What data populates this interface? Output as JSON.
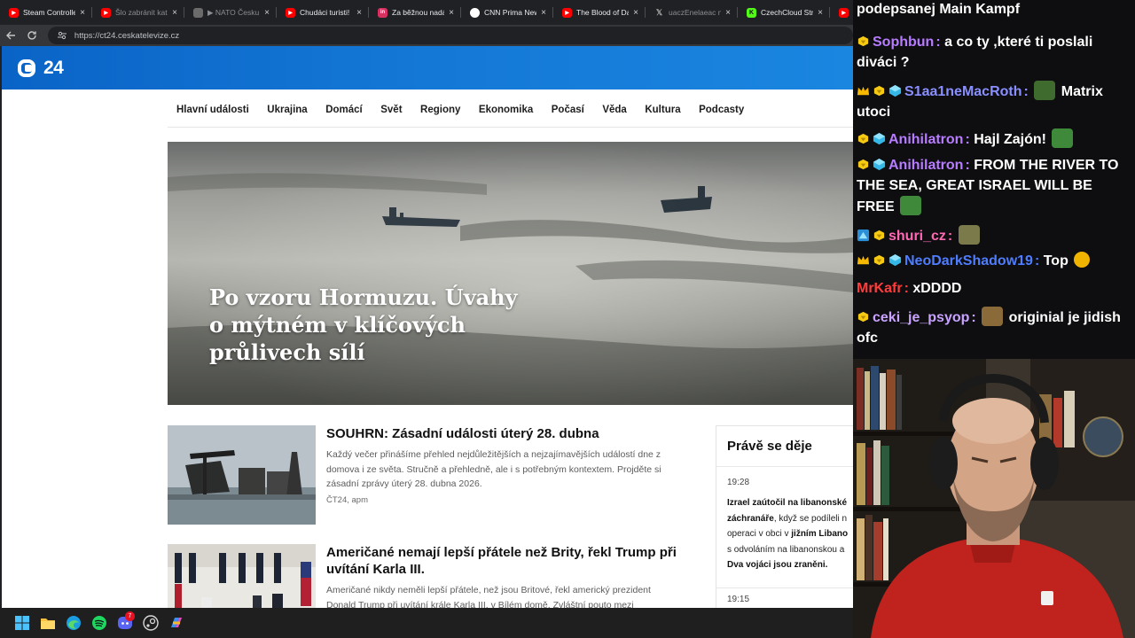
{
  "browser": {
    "tabs": [
      {
        "title": "Steam Controller:",
        "favicon_color": "#ff0000",
        "favicon": "yt"
      },
      {
        "title": "Šlo zabránit katas",
        "favicon_color": "#ff0000",
        "favicon": "yt"
      },
      {
        "title": "▶ NATO Česku ne",
        "favicon_color": "#6b6b6b",
        "favicon": "img"
      },
      {
        "title": "Chudáci turisti! Sk",
        "favicon_color": "#ff0000",
        "favicon": "yt"
      },
      {
        "title": "Za běžnou nadávk",
        "favicon_color": "#d9315f",
        "favicon": "in"
      },
      {
        "title": "CNN Prima News",
        "favicon_color": "#ffffff",
        "favicon": "cnn"
      },
      {
        "title": "The Blood of Daw",
        "favicon_color": "#ff0000",
        "favicon": "yt"
      },
      {
        "title": "uaczEnelaeac na g",
        "favicon_color": "#3a3a3a",
        "favicon": "x"
      },
      {
        "title": "CzechCloud Strea",
        "favicon_color": "#53fc18",
        "favicon": "k"
      },
      {
        "title": "The",
        "favicon_color": "#ff0000",
        "favicon": "yt"
      }
    ],
    "url": "https://ct24.ceskatelevize.cz"
  },
  "site": {
    "logo_text": "24",
    "menu": [
      "Hlavní události",
      "Ukrajina",
      "Domácí",
      "Svět",
      "Regiony",
      "Ekonomika",
      "Počasí",
      "Věda",
      "Kultura",
      "Podcasty"
    ],
    "hero_title": "Po vzoru Hormuzu. Úvahy o mýtném v klíčových průlivech sílí",
    "articles": [
      {
        "headline": "SOUHRN: Zásadní události úterý 28. dubna",
        "perex": "Každý večer přinášíme přehled nejdůležitějších a nejzajímavějších událostí dne z domova i ze světa. Stručně a přehledně, ale i s potřebným kontextem. Projděte si zásadní zprávy úterý 28. dubna 2026.",
        "meta": "ČT24, apm"
      },
      {
        "headline": "Američané nemají lepší přátele než Brity, řekl Trump při uvítání Karla III.",
        "perex": "Američané nikdy neměli lepší přátele, než jsou Britové, řekl americký prezident Donald Trump při uvítání krále Karla III. v Bílém domě. Zvláštní pouto mezi",
        "meta": ""
      }
    ],
    "live": {
      "title": "Právě se děje",
      "items": [
        {
          "time": "19:28"
        },
        {
          "time": "19:15"
        }
      ],
      "l1a": "Izrael zaútočil na libanonské",
      "l2a": "záchranáře",
      "l2b": ", když se podíleli n",
      "l3": "operaci v obci v ",
      "l3b": "jižním Libano",
      "l4": "s odvoláním na libanonskou a",
      "l5": "Dva vojáci jsou zraněni."
    }
  },
  "chat": {
    "messages": [
      {
        "badges": [
          "gold"
        ],
        "user": "",
        "text": "",
        "partial": "podepsanej Main Kampf",
        "color": "#ffffff"
      },
      {
        "badges": [
          "gold"
        ],
        "user": "Sophbun",
        "color": "#b77cff",
        "text": "a co ty ,které ti poslali diváci ?"
      },
      {
        "badges": [
          "crown",
          "gold",
          "cube"
        ],
        "user": "S1aa1neMacRoth",
        "color": "#8a8fff",
        "emote": "pepe-helmet",
        "text": "Matrix utoci"
      },
      {
        "badges": [
          "gold",
          "cube"
        ],
        "user": "Anihilatron",
        "color": "#b77cff",
        "text": "Hajl Zajón!",
        "emote_after": "pepe-cap"
      },
      {
        "badges": [
          "gold",
          "cube"
        ],
        "user": "Anihilatron",
        "color": "#b77cff",
        "text": "FROM THE RIVER TO THE SEA, GREAT ISRAEL WILL BE FREE",
        "emote_after": "pepe-cap"
      },
      {
        "badges": [
          "blue",
          "gold"
        ],
        "user": "shuri_cz",
        "color": "#ff69b4",
        "emote": "toad",
        "text": ""
      },
      {
        "badges": [
          "crown",
          "gold",
          "cube"
        ],
        "user": "NeoDarkShadow19",
        "color": "#4f7dff",
        "text": "Top",
        "emote_after": "laugh"
      },
      {
        "badges": [],
        "user": "MrKafr",
        "color": "#ff3b3b",
        "text": "xDDDD"
      },
      {
        "badges": [
          "gold"
        ],
        "user": "ceki_je_psyop",
        "color": "#c9a3ff",
        "emote": "pepe-box",
        "text": "originial je jidish ofc"
      }
    ]
  },
  "taskbar": {
    "icons": [
      "windows-start",
      "file-explorer",
      "edge",
      "spotify",
      "discord",
      "steam",
      "copilot"
    ],
    "discord_badge": "7"
  }
}
